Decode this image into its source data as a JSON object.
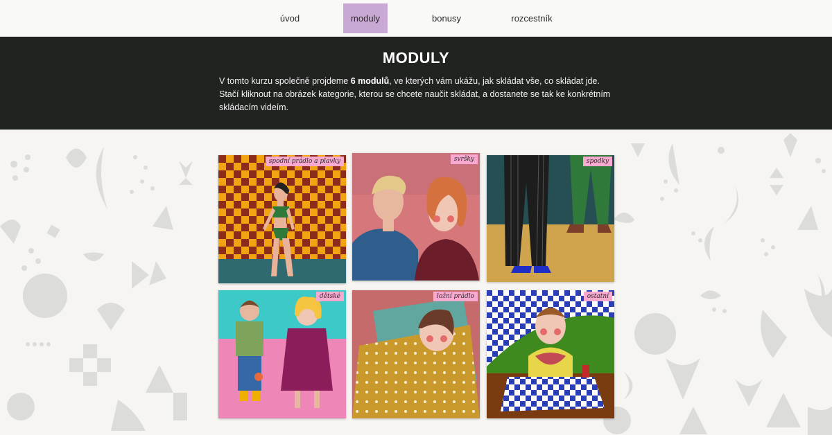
{
  "nav": {
    "items": [
      {
        "label": "úvod"
      },
      {
        "label": "moduly",
        "active": true
      },
      {
        "label": "bonusy"
      },
      {
        "label": "rozcestník"
      }
    ],
    "active_color": "#c9a8d4"
  },
  "header": {
    "title": "MODULY",
    "intro_before": "V tomto kurzu společně projdeme ",
    "intro_bold": "6 modulů",
    "intro_after": ", ve kterých vám ukážu, jak skládat vše, co skládat jde. Stačí kliknout na obrázek kategorie, kterou se chcete naučit skládat, a dostanete se tak ke konkrétním skládacím videím.",
    "background": "#202320"
  },
  "modules": [
    {
      "label": "spodní prádlo a plavky",
      "icon": "underwear-illustration"
    },
    {
      "label": "svršky",
      "icon": "couple-illustration"
    },
    {
      "label": "spodky",
      "icon": "trousers-illustration"
    },
    {
      "label": "dětské",
      "icon": "children-illustration"
    },
    {
      "label": "ložní prádlo",
      "icon": "bedding-illustration"
    },
    {
      "label": "ostatní",
      "icon": "tablecloth-illustration"
    }
  ],
  "colors": {
    "label_bg": "#f7a9cf",
    "page_bg": "#f6f5f2",
    "pattern": "#dcdcd9"
  }
}
